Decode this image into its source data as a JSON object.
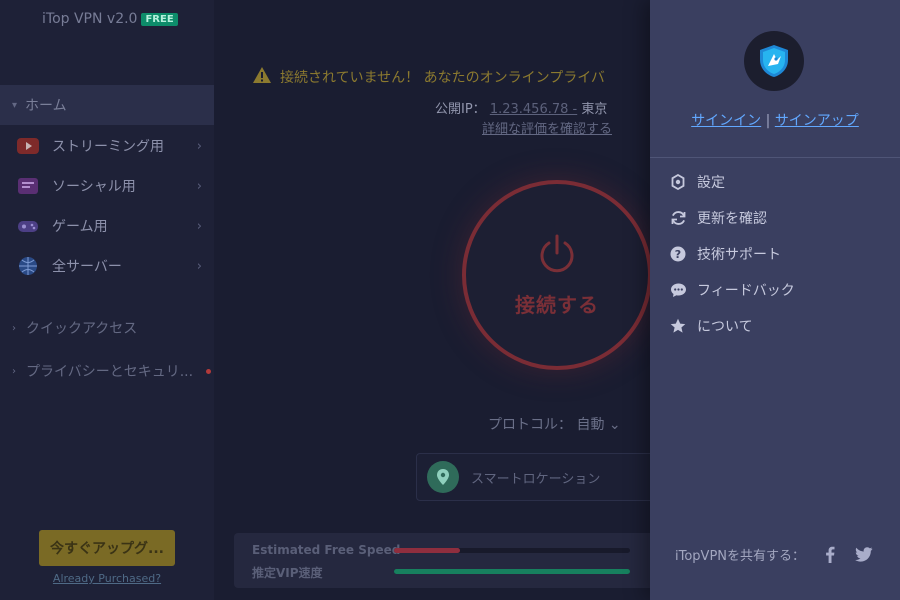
{
  "app": {
    "title": "iTop VPN v2.0",
    "badge": "FREE"
  },
  "sidebar": {
    "home_label": "ホーム",
    "items": [
      {
        "label": "ストリーミング用",
        "icon": "youtube-icon"
      },
      {
        "label": "ソーシャル用",
        "icon": "social-icon"
      },
      {
        "label": "ゲーム用",
        "icon": "gamepad-icon"
      },
      {
        "label": "全サーバー",
        "icon": "globe-icon"
      }
    ],
    "quick_access": "クイックアクセス",
    "privacy": "プライバシーとセキュリ...",
    "upgrade_label": "今すぐアップグ...",
    "already_purchased": "Already Purchased?"
  },
  "main": {
    "warning": "接続されていません！ あなたのオンラインプライバ",
    "ip_label": "公開IP：",
    "ip_value": "1.23.456.78 -",
    "ip_city": "東京",
    "details_link": "詳細な評価を確認する",
    "connect_label": "接続する",
    "protocol_label": "プロトコル：",
    "protocol_value": "自動",
    "smart_location": "スマートロケーション",
    "speed_free": "Estimated Free Speed",
    "speed_vip": "推定VIP速度",
    "speed_free_level": 0.28,
    "speed_vip_level": 1.0
  },
  "panel": {
    "sign_in": "サインイン",
    "separator": "|",
    "sign_up": "サインアップ",
    "menu": [
      {
        "label": "設定",
        "icon": "gear-icon"
      },
      {
        "label": "更新を確認",
        "icon": "refresh-icon"
      },
      {
        "label": "技術サポート",
        "icon": "help-icon"
      },
      {
        "label": "フィードバック",
        "icon": "feedback-icon"
      },
      {
        "label": "について",
        "icon": "star-icon"
      }
    ],
    "share_label": "iTopVPNを共有する："
  },
  "colors": {
    "panel_bg": "#3a3f60",
    "link": "#62a8ff",
    "free_badge": "#0d8c6a",
    "connect_ring": "#7a2c35",
    "speed_free_bar": "#8f2e3e",
    "speed_vip_bar": "#17805e"
  }
}
